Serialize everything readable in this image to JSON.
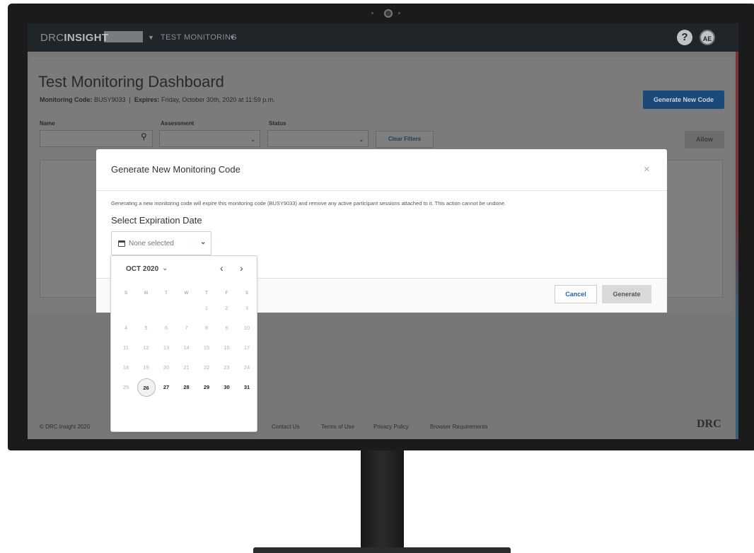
{
  "app": {
    "logo": {
      "prefix": "DRC",
      "word": "INSIGHT"
    },
    "nav_link": "TEST MONITORING",
    "help_icon": "?",
    "avatar_initials": "AE"
  },
  "page": {
    "title": "Test Monitoring Dashboard",
    "code_label": "Monitoring Code:",
    "code_value": "BUSY9033",
    "separator": "|",
    "expires_label": "Expires:",
    "expires_value": "Friday, October 30th, 2020 at 11:59 p.m.",
    "generate_button": "Generate New Code",
    "filters": {
      "name_label": "Name",
      "assessment_label": "Assessment",
      "status_label": "Status",
      "clear_button": "Clear Filters",
      "allow_button": "Allow"
    }
  },
  "footer": {
    "copyright": "© DRC Insight 2020",
    "links": [
      "Contact Us",
      "Terms of Use",
      "Privacy Policy",
      "Browser Requirements"
    ],
    "brand": "DRC"
  },
  "modal": {
    "title": "Generate New Monitoring Code",
    "close": "×",
    "description": "Generating a new monitoring code will expire this monitoring code (BUSY9033) and remove any active participant sessions attached to it. This action cannot be undone.",
    "section_title": "Select Expiration Date",
    "date_placeholder": "None selected",
    "cancel_button": "Cancel",
    "generate_button": "Generate"
  },
  "calendar": {
    "month_label": "OCT 2020",
    "weekdays": [
      "S",
      "M",
      "T",
      "W",
      "T",
      "F",
      "S"
    ],
    "weeks": [
      [
        "",
        "",
        "",
        "",
        "1",
        "2",
        "3"
      ],
      [
        "4",
        "5",
        "6",
        "7",
        "8",
        "9",
        "10"
      ],
      [
        "11",
        "12",
        "13",
        "14",
        "15",
        "16",
        "17"
      ],
      [
        "18",
        "19",
        "20",
        "21",
        "22",
        "23",
        "24"
      ],
      [
        "25",
        "26",
        "27",
        "28",
        "29",
        "30",
        "31"
      ]
    ],
    "today": "26",
    "selectable": [
      "26",
      "27",
      "28",
      "29",
      "30",
      "31"
    ]
  }
}
